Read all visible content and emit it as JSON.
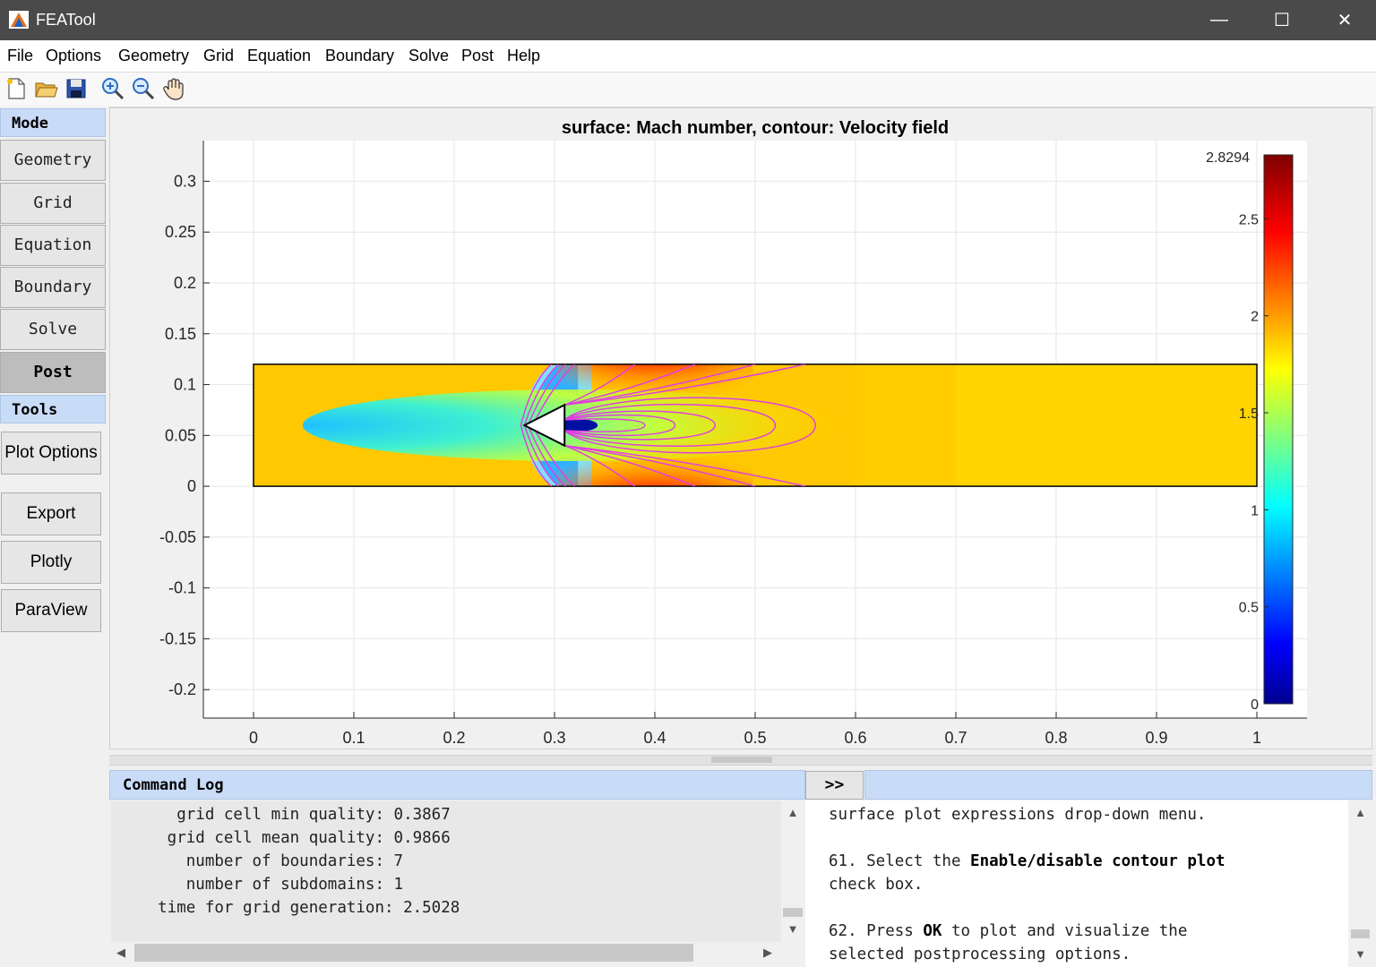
{
  "window": {
    "title": "FEATool",
    "minimize": "—",
    "maximize": "☐",
    "close": "✕"
  },
  "menu": [
    "File",
    "Options",
    "Geometry",
    "Grid",
    "Equation",
    "Boundary",
    "Solve",
    "Post",
    "Help"
  ],
  "toolbar": {
    "icons": [
      "new-file-icon",
      "open-folder-icon",
      "save-icon",
      "zoom-in-icon",
      "zoom-out-icon",
      "pan-hand-icon"
    ]
  },
  "left_panel": {
    "mode_header": "Mode",
    "mode_buttons": [
      "Geometry",
      "Grid",
      "Equation",
      "Boundary",
      "Solve",
      "Post"
    ],
    "active_mode": "Post",
    "tools_header": "Tools",
    "tool_buttons": [
      "Plot Options",
      "Export",
      "Plotly",
      "ParaView"
    ]
  },
  "chart_data": {
    "type": "heatmap",
    "title": "surface: Mach number, contour: Velocity field",
    "xlabel": "",
    "ylabel": "",
    "xlim": [
      -0.05,
      1.05
    ],
    "ylim": [
      -0.228,
      0.34
    ],
    "xticks": [
      "0",
      "0.1",
      "0.2",
      "0.3",
      "0.4",
      "0.5",
      "0.6",
      "0.7",
      "0.8",
      "0.9",
      "1"
    ],
    "yticks": [
      "0.3",
      "0.25",
      "0.2",
      "0.15",
      "0.1",
      "0.05",
      "0",
      "-0.05",
      "-0.1",
      "-0.15",
      "-0.2"
    ],
    "grid": true,
    "domain": {
      "xmin": 0,
      "xmax": 1,
      "ymin": 0,
      "ymax": 0.12
    },
    "obstacle": {
      "shape": "triangle",
      "tip": [
        0.27,
        0.06
      ],
      "base_x": 0.31,
      "half_height": 0.02
    },
    "colorbar": {
      "min": 0,
      "max": 2.8294,
      "max_label": "2.8294",
      "ticks": [
        "2.5",
        "2",
        "1.5",
        "1",
        "0.5",
        "0"
      ],
      "colormap": "jet"
    },
    "contour_color": "#e040e0"
  },
  "command_log": {
    "header": "Command Log",
    "lines": [
      "      grid cell min quality: 0.3867",
      "     grid cell mean quality: 0.9866",
      "       number of boundaries: 7",
      "       number of subdomains: 1",
      "    time for grid generation: 2.5028"
    ]
  },
  "help_panel": {
    "toggle_label": ">>",
    "line1": "surface plot expressions drop-down menu.",
    "step61_prefix": "61. Select the ",
    "step61_bold": "Enable/disable contour plot",
    "step61_line2": "check box.",
    "step62_prefix": "62. Press ",
    "step62_bold": "OK",
    "step62_suffix": " to plot and visualize the",
    "step62_line2": "selected postprocessing options."
  }
}
